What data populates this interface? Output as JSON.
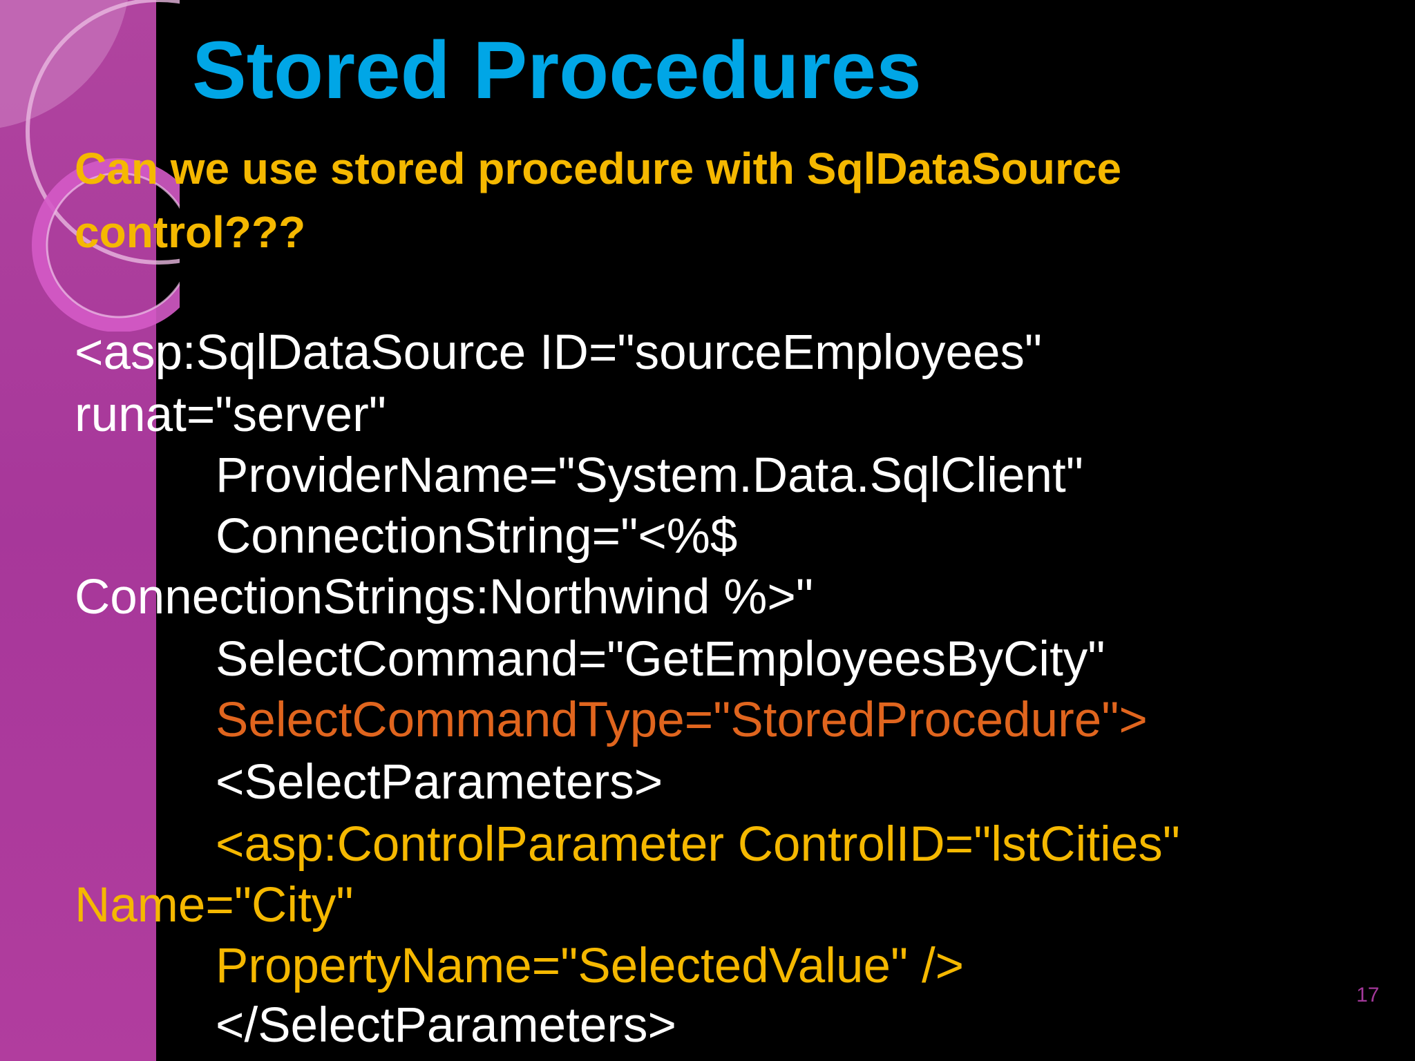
{
  "slide": {
    "title": "Stored Procedures",
    "question": "Can we use stored procedure with SqlDataSource control???",
    "code_lines": [
      "<asp:SqlDataSource ID=\"sourceEmployees\"",
      "runat=\"server\"",
      "ProviderName=\"System.Data.SqlClient\"",
      "ConnectionString=\"<%$",
      "ConnectionStrings:Northwind %>\"",
      "SelectCommand=\"GetEmployeesByCity\"",
      "SelectCommandType=\"StoredProcedure\">",
      "<SelectParameters>",
      "<asp:ControlParameter ControlID=\"lstCities\"",
      "Name=\"City\"",
      "PropertyName=\"SelectedValue\" />",
      "</SelectParameters>"
    ],
    "page_number": "17"
  },
  "colors": {
    "background": "#000000",
    "sidebar": "#a7379a",
    "title": "#00a6e6",
    "question": "#f5b800",
    "code_default": "#ffffff",
    "code_highlight_orange": "#e0651e",
    "code_highlight_yellow": "#f5b800",
    "page_number": "#a3389a"
  }
}
